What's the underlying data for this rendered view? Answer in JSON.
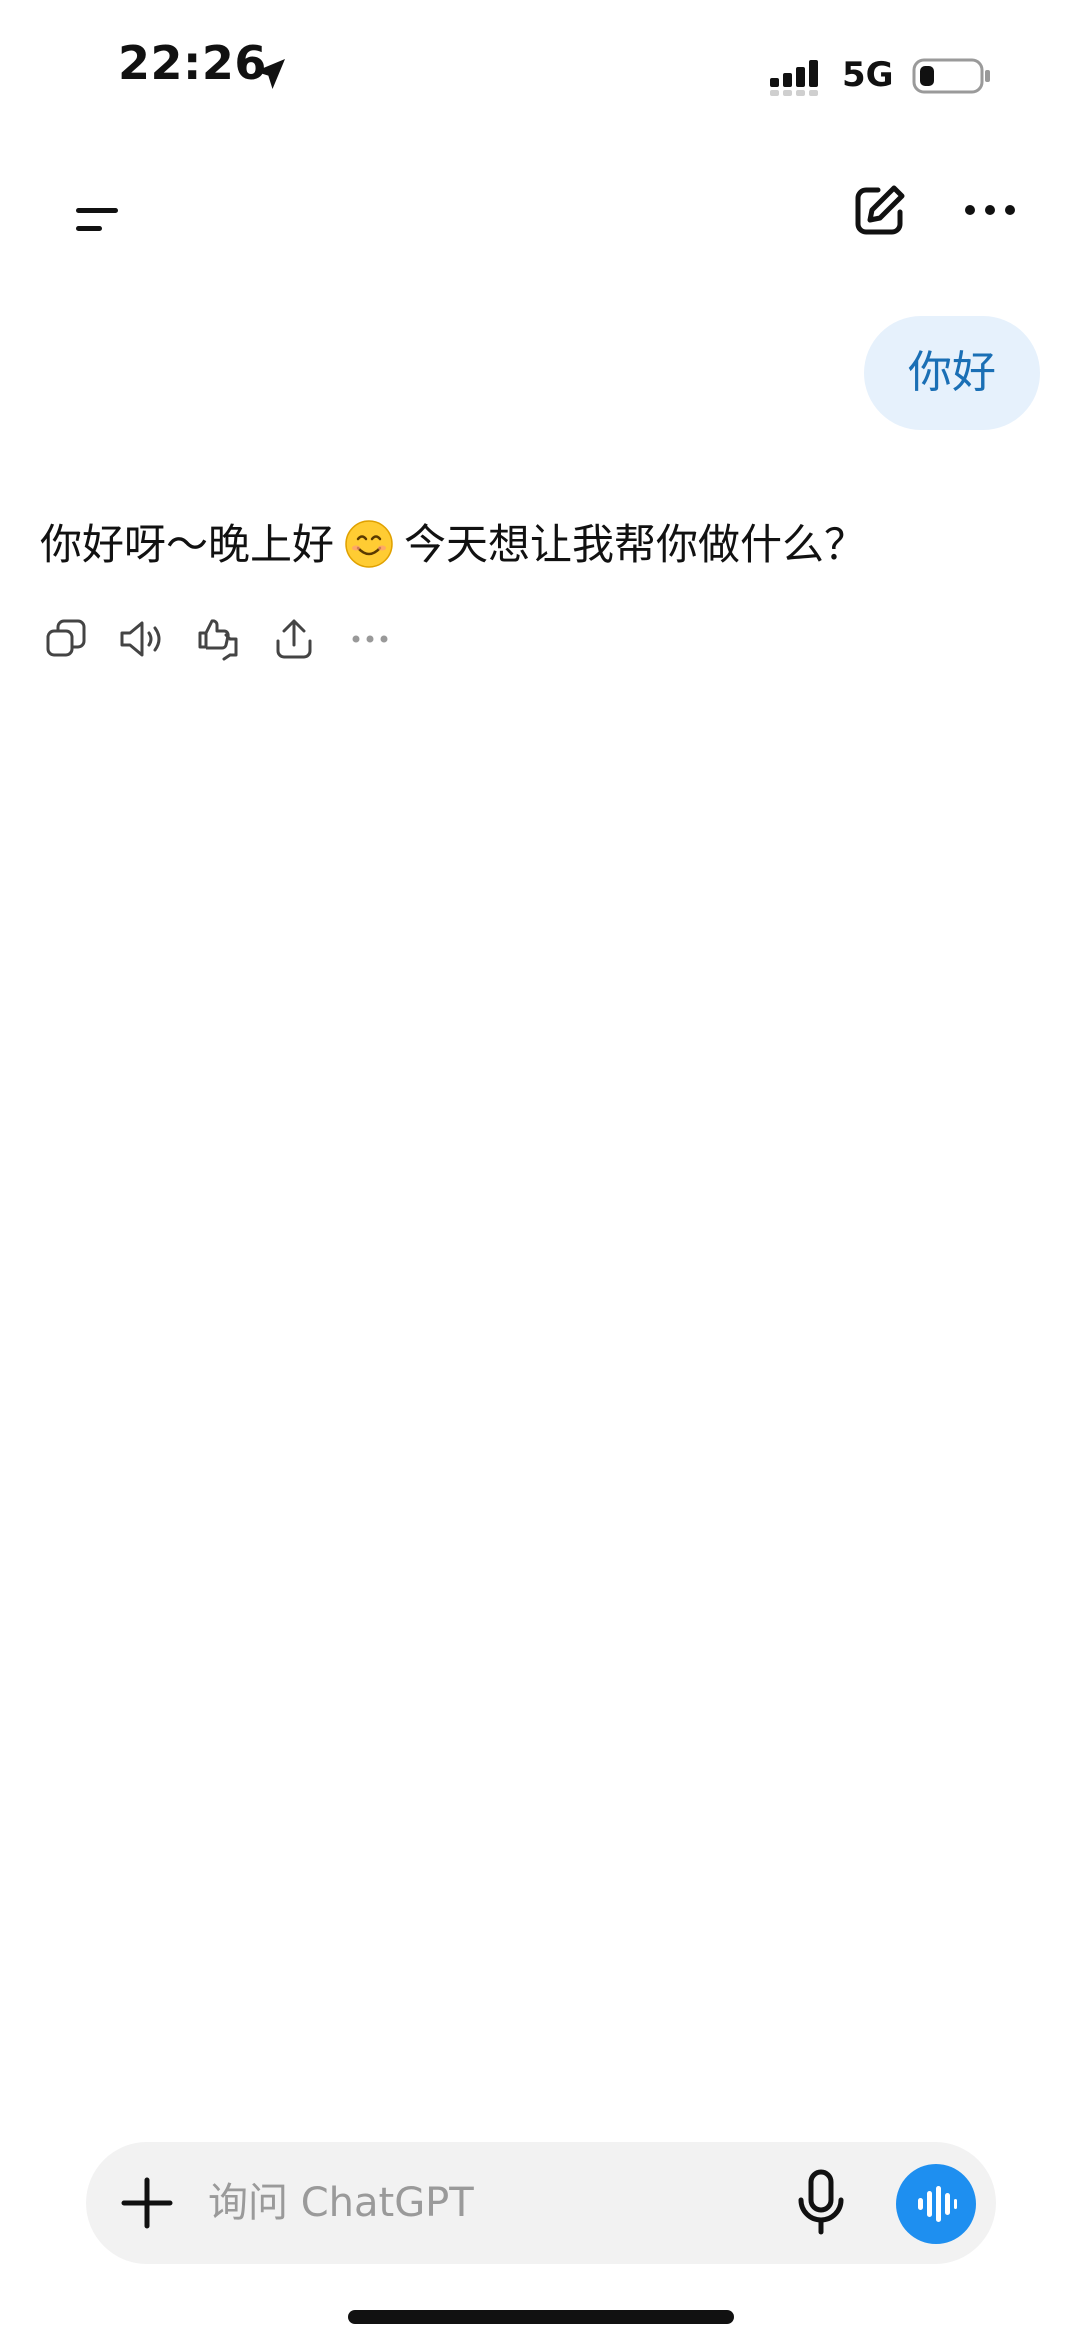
{
  "status_bar": {
    "time": "22:26",
    "network": "5G",
    "icons": [
      "location-arrow-icon",
      "signal-icon",
      "battery-icon"
    ]
  },
  "top_nav": {
    "icons": [
      "menu-icon",
      "new-chat-edit-icon",
      "more-icon"
    ]
  },
  "conversation": {
    "user_message": "你好",
    "assistant_message_part1": "你好呀～晚上好",
    "assistant_message_emoji": "smiling-face-emoji-icon",
    "assistant_message_part2": "今天想让我帮你做什么？",
    "actions": [
      "copy-icon",
      "read-aloud-icon",
      "thumbs-up-down-icon",
      "share-icon",
      "more-icon"
    ]
  },
  "composer": {
    "placeholder": "询问 ChatGPT",
    "value": "",
    "icons": [
      "plus-icon",
      "microphone-icon",
      "voice-waveform-icon"
    ]
  },
  "colors": {
    "accent": "#1e8ff0",
    "user_bubble_bg": "#e6f1fc",
    "user_bubble_text": "#1a6fb5",
    "composer_bg": "#f2f2f2"
  }
}
